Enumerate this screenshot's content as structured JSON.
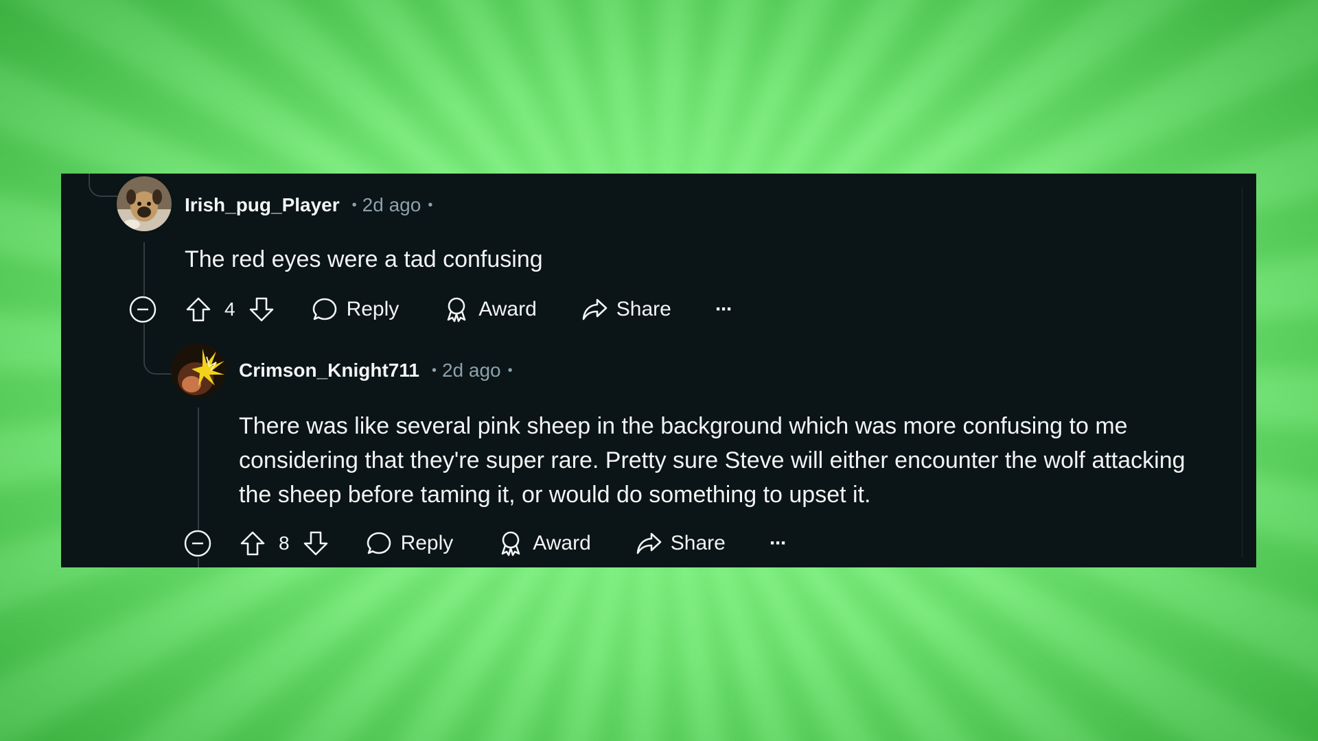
{
  "comments": [
    {
      "username": "Irish_pug_Player",
      "time": "2d ago",
      "body": "The red eyes were a tad confusing",
      "votes": "4",
      "actions": {
        "reply": "Reply",
        "award": "Award",
        "share": "Share",
        "more": "···"
      }
    },
    {
      "username": "Crimson_Knight711",
      "time": "2d ago",
      "body": "There was like several pink sheep in the background which was more confusing to me considering that they're super rare. Pretty sure Steve will either encounter the wolf attacking the sheep before taming it, or would do something to upset it.",
      "votes": "8",
      "actions": {
        "reply": "Reply",
        "award": "Award",
        "share": "Share",
        "more": "···"
      }
    }
  ],
  "theme": {
    "background": "#0b1416",
    "text": "#f2f4f5",
    "muted": "#8ba2ad",
    "thread_line": "#333d42",
    "backdrop": "#7cf47e"
  },
  "icons": [
    "collapse-icon",
    "upvote-icon",
    "downvote-icon",
    "reply-icon",
    "award-icon",
    "share-icon",
    "more-icon"
  ]
}
